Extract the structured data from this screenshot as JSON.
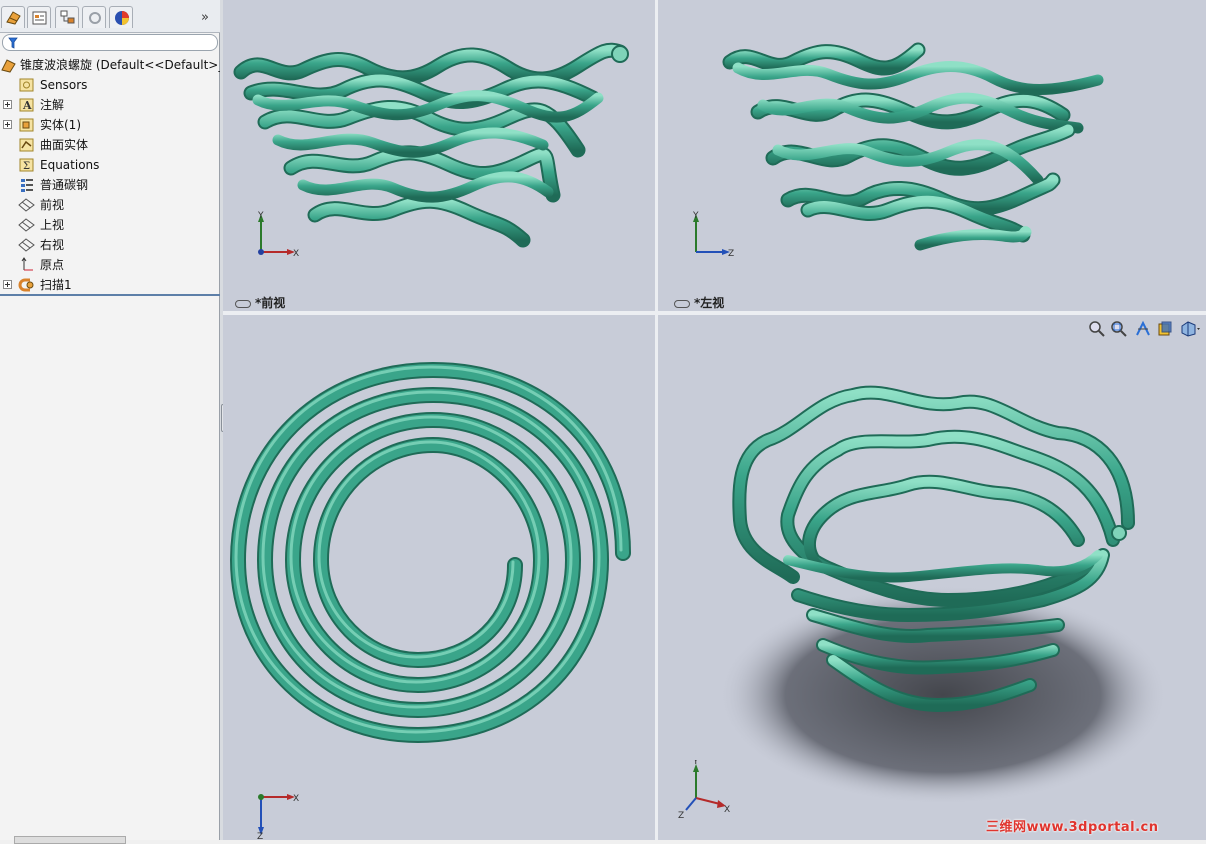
{
  "colors": {
    "tube": "#3aa58a",
    "tube_dark": "#1f6b57",
    "tube_light": "#7fd3b9",
    "viewport_bg": "#c8ccd8",
    "panel_bg": "#f3f3f3",
    "watermark": "#e0342e"
  },
  "panel": {
    "tabs": [
      {
        "name": "featuremanager-tab",
        "icon": "featuremanager-icon"
      },
      {
        "name": "propertymanager-tab",
        "icon": "propertymanager-icon"
      },
      {
        "name": "configurationmanager-tab",
        "icon": "configurationmanager-icon"
      },
      {
        "name": "dimxpert-tab",
        "icon": "dimxpert-icon"
      },
      {
        "name": "appearance-tab",
        "icon": "appearance-icon"
      }
    ],
    "more": "»",
    "filter_icon": "filter-icon",
    "tree": [
      {
        "label": "锥度波浪螺旋  (Default<<Default>_",
        "icon": "part-icon",
        "expandable": false,
        "root": true
      },
      {
        "label": "Sensors",
        "icon": "sensors-icon",
        "expandable": false
      },
      {
        "label": "注解",
        "icon": "annotations-icon",
        "expandable": true
      },
      {
        "label": "实体(1)",
        "icon": "solid-bodies-icon",
        "expandable": true
      },
      {
        "label": "曲面实体",
        "icon": "surface-bodies-icon",
        "expandable": false
      },
      {
        "label": "Equations",
        "icon": "equations-icon",
        "expandable": false
      },
      {
        "label": "普通碳钢",
        "icon": "material-icon",
        "expandable": false
      },
      {
        "label": "前视",
        "icon": "plane-icon",
        "expandable": false
      },
      {
        "label": "上视",
        "icon": "plane-icon",
        "expandable": false
      },
      {
        "label": "右视",
        "icon": "plane-icon",
        "expandable": false
      },
      {
        "label": "原点",
        "icon": "origin-icon",
        "expandable": false
      },
      {
        "label": "扫描1",
        "icon": "sweep-icon",
        "expandable": true
      }
    ]
  },
  "viewports": {
    "front": {
      "label": "*前视",
      "triad": [
        "Y",
        "X"
      ]
    },
    "left": {
      "label": "*左视",
      "triad": [
        "Y",
        "Z"
      ]
    },
    "top": {
      "label": "",
      "triad": [
        "X",
        "Z"
      ]
    },
    "iso": {
      "label": "",
      "triad": [
        "Y",
        "X",
        "Z"
      ]
    }
  },
  "hud": [
    "zoom-to-fit-icon",
    "zoom-to-area-icon",
    "section-view-icon",
    "view-orientation-icon",
    "display-style-icon"
  ],
  "watermark": "三维网www.3dportal.cn"
}
